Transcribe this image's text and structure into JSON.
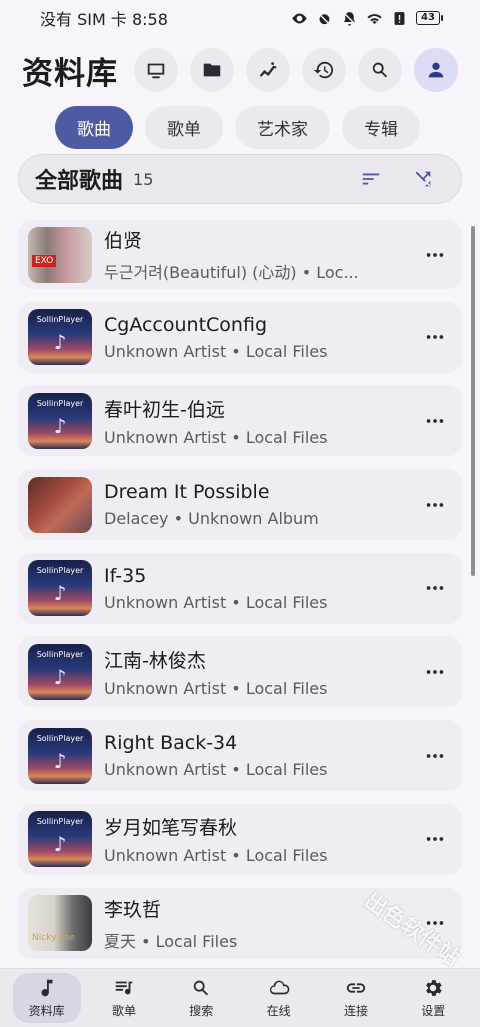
{
  "status": {
    "carrier_time": "没有 SIM 卡 8:58",
    "battery": "43"
  },
  "header": {
    "title": "资料库"
  },
  "tabs": [
    {
      "label": "歌曲",
      "active": true
    },
    {
      "label": "歌单",
      "active": false
    },
    {
      "label": "艺术家",
      "active": false
    },
    {
      "label": "专辑",
      "active": false
    }
  ],
  "section": {
    "title": "全部歌曲",
    "count": "15"
  },
  "songs": [
    {
      "title": "伯贤",
      "subtitle": "두근거려(Beautiful) (心动) • Loc...",
      "cover": "exo"
    },
    {
      "title": "CgAccountConfig",
      "subtitle": "Unknown Artist • Local Files",
      "cover": "sollin"
    },
    {
      "title": "春叶初生-伯远",
      "subtitle": "Unknown Artist • Local Files",
      "cover": "sollin"
    },
    {
      "title": "Dream It Possible",
      "subtitle": "Delacey • Unknown Album",
      "cover": "red"
    },
    {
      "title": "If-35",
      "subtitle": "Unknown Artist • Local Files",
      "cover": "sollin"
    },
    {
      "title": "江南-林俊杰",
      "subtitle": "Unknown Artist • Local Files",
      "cover": "sollin"
    },
    {
      "title": "Right Back-34",
      "subtitle": "Unknown Artist • Local Files",
      "cover": "sollin"
    },
    {
      "title": "岁月如笔写春秋",
      "subtitle": "Unknown Artist • Local Files",
      "cover": "sollin"
    },
    {
      "title": "李玖哲",
      "subtitle": "夏天 • Local Files",
      "cover": "lee"
    }
  ],
  "cover_text": {
    "sollin": "SollinPlayer",
    "exo": "EXO",
    "lee": "Nicky Lee"
  },
  "bottom_nav": [
    {
      "label": "资料库",
      "icon": "music-note-icon",
      "active": true
    },
    {
      "label": "歌单",
      "icon": "queue-music-icon",
      "active": false
    },
    {
      "label": "搜索",
      "icon": "search-icon",
      "active": false
    },
    {
      "label": "在线",
      "icon": "cloud-icon",
      "active": false
    },
    {
      "label": "连接",
      "icon": "link-icon",
      "active": false
    },
    {
      "label": "设置",
      "icon": "gear-icon",
      "active": false
    }
  ],
  "watermark": "出色软件站",
  "colors": {
    "accent": "#4f5aa3",
    "background": "#f7f5fb",
    "row_bg": "#efedf3"
  }
}
